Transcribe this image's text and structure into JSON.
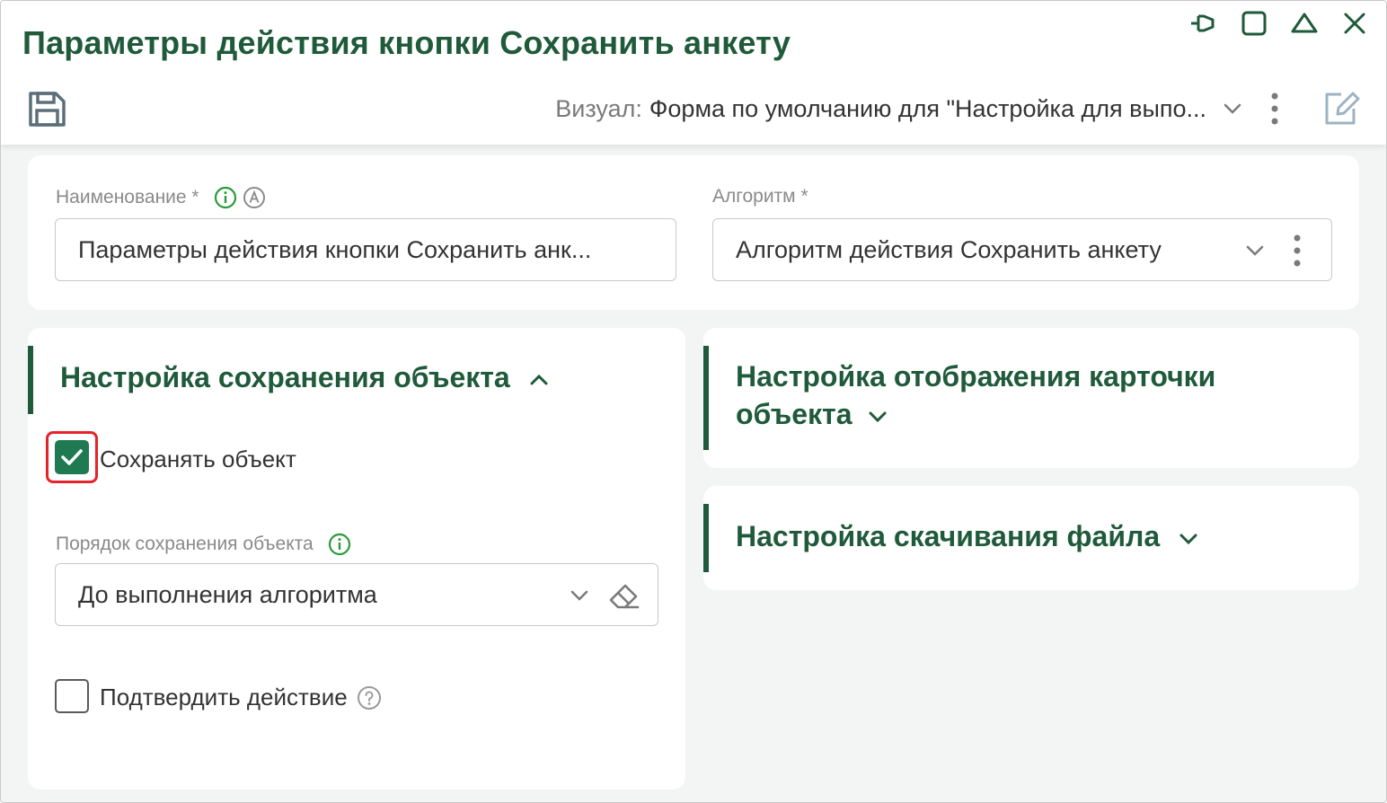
{
  "window": {
    "title": "Параметры действия кнопки Сохранить анкету",
    "controls": [
      "pin-icon",
      "maximize-icon",
      "collapse-icon",
      "close-icon"
    ]
  },
  "toolbar": {
    "save_icon": "floppy-disk-icon",
    "visual_label": "Визуал:",
    "visual_value": "Форма по умолчанию для \"Настройка для выпо...",
    "kebab_icon": "kebab-vertical-icon",
    "edit_icon": "edit-pencil-icon"
  },
  "top_card": {
    "name_field": {
      "label": "Наименование *",
      "value": "Параметры действия кнопки Сохранить анк..."
    },
    "algorithm_field": {
      "label": "Алгоритм *",
      "value": "Алгоритм действия Сохранить анкету"
    }
  },
  "save_section": {
    "title": "Настройка сохранения объекта",
    "expanded": true,
    "save_object": {
      "label": "Сохранять объект",
      "checked": true
    },
    "order_field": {
      "label": "Порядок сохранения объекта",
      "value": "До выполнения алгоритма"
    },
    "confirm_action": {
      "label": "Подтвердить действие",
      "checked": false
    }
  },
  "card_display_section": {
    "title_line1": "Настройка отображения карточки",
    "title_line2": "объекта",
    "expanded": false
  },
  "download_section": {
    "title": "Настройка скачивания файла",
    "expanded": false
  },
  "colors": {
    "accent": "#1f5a3a",
    "checkbox_green": "#1f7a52",
    "info_green": "#2a9a3a",
    "highlight_red": "#e3242b"
  }
}
